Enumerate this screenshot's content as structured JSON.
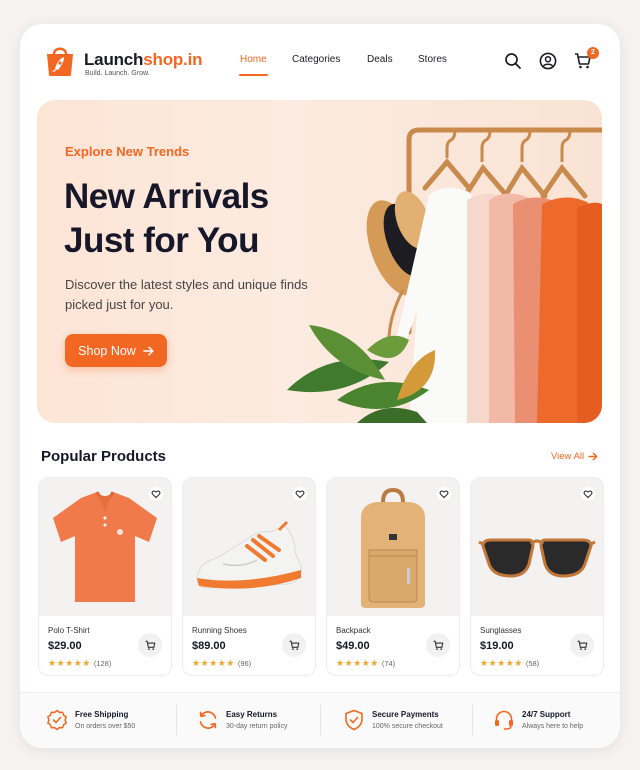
{
  "brand": {
    "name_part1": "Launch",
    "name_part2": "shop.in",
    "tagline": "Build. Launch. Grow.",
    "accent_color": "#f26722"
  },
  "nav": {
    "items": [
      "Home",
      "Categories",
      "Deals",
      "Stores"
    ],
    "active": "Home"
  },
  "header_icons": [
    "search-icon",
    "user-icon",
    "cart-icon"
  ],
  "cart_count": "2",
  "hero": {
    "kicker": "Explore New Trends",
    "title_line1": "New Arrivals",
    "title_line2": "Just for You",
    "subtitle": "Discover the latest styles and unique finds picked just for you.",
    "cta_label": "Shop Now"
  },
  "popular": {
    "title": "Popular Products",
    "view_all": "View All",
    "products": [
      {
        "name": "Polo T-Shirt",
        "price": "$29.00",
        "rating": 4.5,
        "reviews": "(128)",
        "image": "orange-polo-shirt"
      },
      {
        "name": "Running Shoes",
        "price": "$89.00",
        "rating": 4.5,
        "reviews": "(96)",
        "image": "white-orange-sneaker"
      },
      {
        "name": "Backpack",
        "price": "$49.00",
        "rating": 4.5,
        "reviews": "(74)",
        "image": "tan-backpack"
      },
      {
        "name": "Sunglasses",
        "price": "$19.00",
        "rating": 4.5,
        "reviews": "(58)",
        "image": "tortoise-sunglasses"
      }
    ]
  },
  "features": [
    {
      "title": "Free Shipping",
      "subtitle": "On orders over $50",
      "icon": "badge-check-icon"
    },
    {
      "title": "Easy Returns",
      "subtitle": "30-day return policy",
      "icon": "refresh-icon"
    },
    {
      "title": "Secure Payments",
      "subtitle": "100% secure checkout",
      "icon": "shield-check-icon"
    },
    {
      "title": "24/7 Support",
      "subtitle": "Always here to help",
      "icon": "headset-icon"
    }
  ]
}
